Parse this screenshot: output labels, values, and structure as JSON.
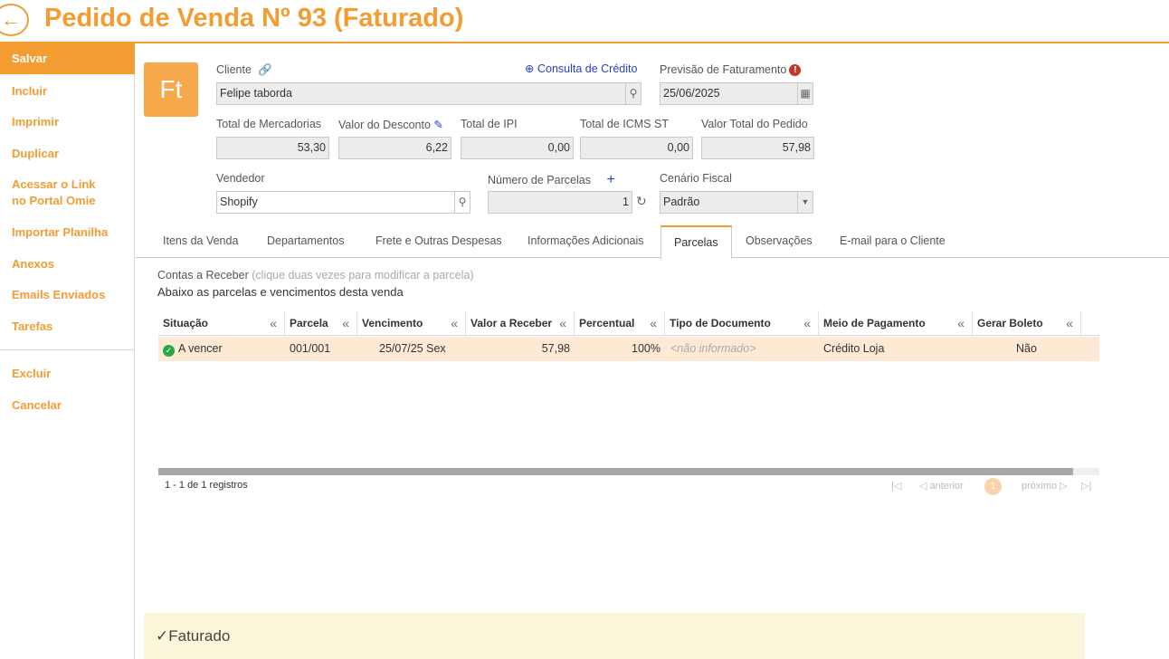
{
  "header": {
    "back_icon": "arrow-left-icon",
    "title": "Pedido de Venda Nº 93 (Faturado)"
  },
  "sidebar": {
    "items": [
      {
        "label": "Salvar"
      },
      {
        "label": "Incluir"
      },
      {
        "label": "Imprimir"
      },
      {
        "label": "Duplicar"
      },
      {
        "label": "Acessar o Link"
      },
      {
        "label": "no Portal Omie"
      },
      {
        "label": "Importar Planilha"
      },
      {
        "label": "Anexos"
      },
      {
        "label": "Emails Enviados"
      },
      {
        "label": "Tarefas"
      },
      {
        "label": "Excluir"
      },
      {
        "label": "Cancelar"
      }
    ]
  },
  "avatar": {
    "initials": "Ft"
  },
  "form": {
    "cliente": {
      "label": "Cliente",
      "value": "Felipe taborda"
    },
    "consulta_credito": "Consulta de Crédito",
    "previsao": {
      "label": "Previsão de Faturamento",
      "value": "25/06/2025",
      "warn": "!"
    },
    "total_mercadorias": {
      "label": "Total de Mercadorias",
      "value": "53,30"
    },
    "valor_desconto": {
      "label": "Valor do Desconto",
      "value": "6,22"
    },
    "total_ipi": {
      "label": "Total de IPI",
      "value": "0,00"
    },
    "total_icms_st": {
      "label": "Total de ICMS ST",
      "value": "0,00"
    },
    "valor_total": {
      "label": "Valor Total do Pedido",
      "value": "57,98"
    },
    "vendedor": {
      "label": "Vendedor",
      "value": "Shopify"
    },
    "num_parcelas": {
      "label": "Número de Parcelas",
      "value": "1",
      "add": "+"
    },
    "cenario_fiscal": {
      "label": "Cenário Fiscal",
      "value": "Padrão"
    }
  },
  "tabs": [
    {
      "label": "Itens da Venda"
    },
    {
      "label": "Departamentos"
    },
    {
      "label": "Frete e Outras Despesas"
    },
    {
      "label": "Informações Adicionais"
    },
    {
      "label": "Parcelas"
    },
    {
      "label": "Observações"
    },
    {
      "label": "E-mail para o Cliente"
    }
  ],
  "contas": {
    "title": "Contas a Receber",
    "hint": "(clique duas vezes para modificar a parcela)",
    "subtitle": "Abaixo as parcelas e vencimentos desta venda"
  },
  "grid": {
    "columns": [
      "Situação",
      "Parcela",
      "Vencimento",
      "Valor a Receber",
      "Percentual",
      "Tipo de Documento",
      "Meio de Pagamento",
      "Gerar Boleto"
    ],
    "collapse_icon": "«",
    "rows": [
      {
        "situacao": "A vencer",
        "parcela": "001/001",
        "vencimento": "25/07/25 Sex",
        "valor": "57,98",
        "percentual": "100%",
        "tipo_documento": "<não informado>",
        "meio_pagamento": "Crédito Loja",
        "gerar_boleto": "Não"
      }
    ]
  },
  "pager": {
    "records": "1 - 1 de 1 registros",
    "anterior": "anterior",
    "proximo": "próximo",
    "page": "1"
  },
  "status": {
    "check": "✓",
    "text": "Faturado"
  }
}
